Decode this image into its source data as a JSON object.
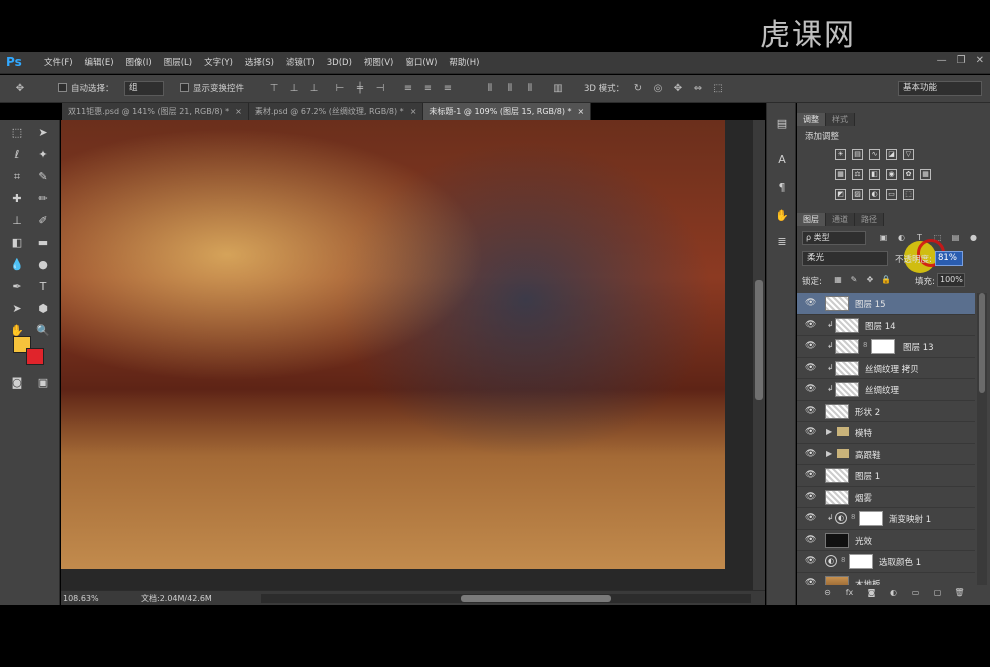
{
  "app": {
    "logo": "Ps"
  },
  "menu": [
    "文件(F)",
    "编辑(E)",
    "图像(I)",
    "图层(L)",
    "文字(Y)",
    "选择(S)",
    "滤镜(T)",
    "3D(D)",
    "视图(V)",
    "窗口(W)",
    "帮助(H)"
  ],
  "options": {
    "auto_select_label": "自动选择：",
    "auto_select_value": "组",
    "show_transform_label": "显示变换控件",
    "mode_3d_label": "3D 模式：",
    "workspace_value": "基本功能"
  },
  "tabs": [
    {
      "label": "双11钜惠.psd @ 141% (图层 21, RGB/8) *",
      "active": false
    },
    {
      "label": "素材.psd @ 67.2% (丝绸纹理, RGB/8) *",
      "active": false
    },
    {
      "label": "未标题-1 @ 109% (图层 15, RGB/8) *",
      "active": true
    }
  ],
  "status": {
    "zoom": "108.63%",
    "doc": "文档:2.04M/42.6M"
  },
  "adjust_panel": {
    "tabs": [
      "调整",
      "样式"
    ],
    "title": "添加调整"
  },
  "layers_panel": {
    "tabs": [
      "图层",
      "通道",
      "路径"
    ],
    "filter_value": "ρ 类型",
    "blend_mode": "柔光",
    "opacity_label": "不透明度:",
    "opacity_value": "81%",
    "lock_label": "锁定:",
    "fill_label": "填充:",
    "fill_value": "100%",
    "layers": [
      {
        "name": "图层 15",
        "kind": "pixel",
        "selected": true
      },
      {
        "name": "图层 14",
        "kind": "pixel",
        "clip": true
      },
      {
        "name": "图层 13",
        "kind": "pixel-mask",
        "clip": true
      },
      {
        "name": "丝绸纹理 拷贝",
        "kind": "pixel",
        "clip": true
      },
      {
        "name": "丝绸纹理",
        "kind": "pixel",
        "clip": true
      },
      {
        "name": "形状 2",
        "kind": "shape"
      },
      {
        "name": "模特",
        "kind": "group"
      },
      {
        "name": "高跟鞋",
        "kind": "group"
      },
      {
        "name": "图层 1",
        "kind": "pixel"
      },
      {
        "name": "烟雾",
        "kind": "pixel"
      },
      {
        "name": "渐变映射 1",
        "kind": "adjustment",
        "clip": true
      },
      {
        "name": "光效",
        "kind": "dark"
      },
      {
        "name": "选取颜色 1",
        "kind": "adjustment"
      },
      {
        "name": "木地板",
        "kind": "wood"
      }
    ]
  },
  "watermark": "虎课网"
}
